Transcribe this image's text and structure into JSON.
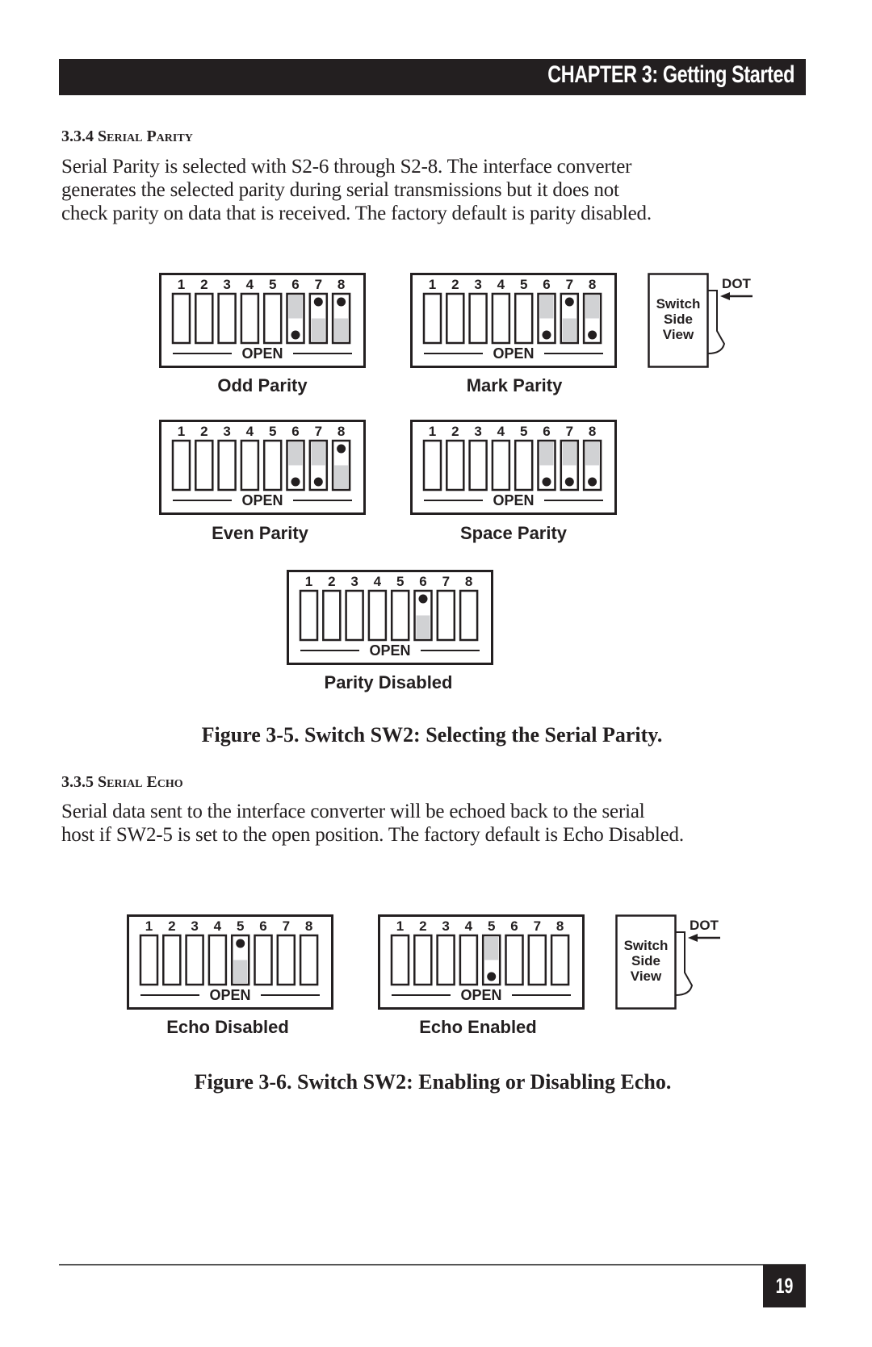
{
  "header": {
    "chapter_title": "CHAPTER 3: Getting Started"
  },
  "section_parity": {
    "title": "3.3.4 Serial Parity",
    "paragraph_lines": [
      "Serial Parity is selected with S2-6 through S2-8. The interface converter",
      "generates the selected parity during serial transmissions but it does not",
      "check parity on data that is received. The factory default is parity disabled."
    ]
  },
  "figure_parity": {
    "caption": "Figure 3-5. Switch SW2: Selecting the Serial Parity.",
    "open_label": "OPEN",
    "switch_numbers": [
      "1",
      "2",
      "3",
      "4",
      "5",
      "6",
      "7",
      "8"
    ],
    "side_view": {
      "lines": [
        "Switch",
        "Side",
        "View"
      ],
      "dot_label": "DOT"
    },
    "configs": [
      {
        "label": "Odd Parity",
        "switches": [
          "none",
          "none",
          "none",
          "none",
          "none",
          "down",
          "up",
          "up"
        ]
      },
      {
        "label": "Mark Parity",
        "switches": [
          "none",
          "none",
          "none",
          "none",
          "none",
          "down",
          "up",
          "down"
        ]
      },
      {
        "label": "Even Parity",
        "switches": [
          "none",
          "none",
          "none",
          "none",
          "none",
          "down",
          "down",
          "up"
        ]
      },
      {
        "label": "Space Parity",
        "switches": [
          "none",
          "none",
          "none",
          "none",
          "none",
          "down",
          "down",
          "down"
        ]
      },
      {
        "label": "Parity Disabled",
        "switches": [
          "none",
          "none",
          "none",
          "none",
          "none",
          "up",
          "none",
          "none"
        ]
      }
    ]
  },
  "section_echo": {
    "title": "3.3.5 Serial Echo",
    "paragraph_lines": [
      "Serial data sent to the interface converter will be echoed back to the serial",
      "host if SW2-5 is set to the open position. The factory default is Echo Disabled."
    ]
  },
  "figure_echo": {
    "caption": "Figure 3-6. Switch SW2: Enabling or Disabling Echo.",
    "open_label": "OPEN",
    "switch_numbers": [
      "1",
      "2",
      "3",
      "4",
      "5",
      "6",
      "7",
      "8"
    ],
    "side_view": {
      "lines": [
        "Switch",
        "Side",
        "View"
      ],
      "dot_label": "DOT"
    },
    "configs": [
      {
        "label": "Echo Disabled",
        "switches": [
          "none",
          "none",
          "none",
          "none",
          "up",
          "none",
          "none",
          "none"
        ]
      },
      {
        "label": "Echo Enabled",
        "switches": [
          "none",
          "none",
          "none",
          "none",
          "down",
          "none",
          "none",
          "none"
        ]
      }
    ]
  },
  "footer": {
    "page_number": "19"
  },
  "colors": {
    "ink": "#231f20",
    "switch_shade": "#d1d2d4"
  }
}
